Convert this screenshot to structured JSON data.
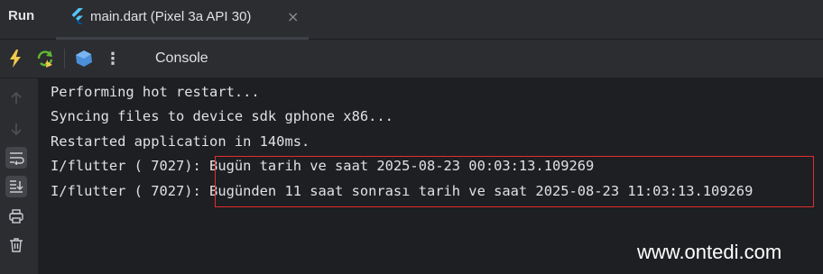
{
  "header": {
    "run_label": "Run",
    "tab": {
      "title": "main.dart (Pixel 3a API 30)",
      "close_glyph": "×",
      "icon": "flutter-icon"
    }
  },
  "toolbar": {
    "icons": [
      "hot-reload-icon",
      "hot-restart-icon",
      "dart-devtools-icon",
      "more-options-icon"
    ],
    "more_glyph": "⋮",
    "console_label": "Console",
    "accent_yellow": "#f2c94c",
    "accent_green": "#5fb832",
    "accent_blue": "#4a8fd8"
  },
  "gutter": {
    "icons": [
      "arrow-up-icon",
      "arrow-down-icon",
      "soft-wrap-icon",
      "scroll-to-end-icon",
      "print-icon",
      "trash-icon"
    ],
    "active": [
      "soft-wrap-icon",
      "scroll-to-end-icon"
    ]
  },
  "console": {
    "lines": [
      "Performing hot restart...",
      "Syncing files to device sdk gphone x86...",
      "Restarted application in 140ms.",
      "I/flutter ( 7027): Bugün tarih ve saat 2025-08-23 00:03:13.109269",
      "I/flutter ( 7027): Bugünden 11 saat sonrası tarih ve saat 2025-08-23 11:03:13.109269"
    ],
    "highlight_color": "#e12d2d"
  },
  "watermark": "www.ontedi.com"
}
